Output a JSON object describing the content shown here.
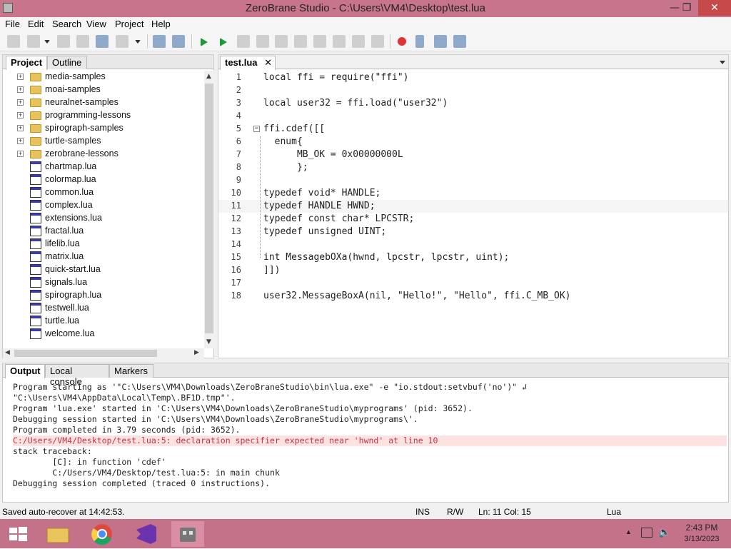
{
  "window": {
    "title": "ZeroBrane Studio - C:\\Users\\VM4\\Desktop\\test.lua",
    "minimize": "—",
    "restore": "❐",
    "close": "✕"
  },
  "menu": [
    "File",
    "Edit",
    "Search",
    "View",
    "Project",
    "Help"
  ],
  "project_panel": {
    "tabs": [
      "Project",
      "Outline"
    ],
    "items": [
      {
        "type": "folder",
        "label": "media-samples"
      },
      {
        "type": "folder",
        "label": "moai-samples"
      },
      {
        "type": "folder",
        "label": "neuralnet-samples"
      },
      {
        "type": "folder",
        "label": "programming-lessons"
      },
      {
        "type": "folder",
        "label": "spirograph-samples"
      },
      {
        "type": "folder",
        "label": "turtle-samples"
      },
      {
        "type": "folder",
        "label": "zerobrane-lessons"
      },
      {
        "type": "file",
        "label": "chartmap.lua"
      },
      {
        "type": "file",
        "label": "colormap.lua"
      },
      {
        "type": "file",
        "label": "common.lua"
      },
      {
        "type": "file",
        "label": "complex.lua"
      },
      {
        "type": "file",
        "label": "extensions.lua"
      },
      {
        "type": "file",
        "label": "fractal.lua"
      },
      {
        "type": "file",
        "label": "lifelib.lua"
      },
      {
        "type": "file",
        "label": "matrix.lua"
      },
      {
        "type": "file",
        "label": "quick-start.lua"
      },
      {
        "type": "file",
        "label": "signals.lua"
      },
      {
        "type": "file",
        "label": "spirograph.lua"
      },
      {
        "type": "file",
        "label": "testwell.lua"
      },
      {
        "type": "file",
        "label": "turtle.lua"
      },
      {
        "type": "file",
        "label": "welcome.lua"
      }
    ]
  },
  "editor": {
    "tab_label": "test.lua",
    "tab_close": "✕",
    "lines": [
      {
        "n": "1",
        "code": "local ffi = require(\"ffi\")"
      },
      {
        "n": "2",
        "code": ""
      },
      {
        "n": "3",
        "code": "local user32 = ffi.load(\"user32\")"
      },
      {
        "n": "4",
        "code": ""
      },
      {
        "n": "5",
        "code": "ffi.cdef([["
      },
      {
        "n": "6",
        "code": "  enum{"
      },
      {
        "n": "7",
        "code": "      MB_OK = 0x00000000L"
      },
      {
        "n": "8",
        "code": "      };"
      },
      {
        "n": "9",
        "code": ""
      },
      {
        "n": "10",
        "code": "typedef void* HANDLE;"
      },
      {
        "n": "11",
        "code": "typedef HANDLE HWND;"
      },
      {
        "n": "12",
        "code": "typedef const char* LPCSTR;"
      },
      {
        "n": "13",
        "code": "typedef unsigned UINT;"
      },
      {
        "n": "14",
        "code": ""
      },
      {
        "n": "15",
        "code": "int MessagebOXa(hwnd, lpcstr, lpcstr, uint);"
      },
      {
        "n": "16",
        "code": "]])"
      },
      {
        "n": "17",
        "code": ""
      },
      {
        "n": "18",
        "code": "user32.MessageBoxA(nil, \"Hello!\", \"Hello\", ffi.C_MB_OK)"
      }
    ],
    "fold_marker": "−"
  },
  "output_panel": {
    "tabs": [
      "Output",
      "Local console",
      "Markers"
    ],
    "lines": [
      {
        "text": "Program starting as '\"C:\\Users\\VM4\\Downloads\\ZeroBraneStudio\\bin\\lua.exe\" -e \"io.stdout:setvbuf('no')\" ↲",
        "error": false
      },
      {
        "text": "\"C:\\Users\\VM4\\AppData\\Local\\Temp\\.BF1D.tmp\"'.",
        "error": false
      },
      {
        "text": "Program 'lua.exe' started in 'C:\\Users\\VM4\\Downloads\\ZeroBraneStudio\\myprograms' (pid: 3652).",
        "error": false
      },
      {
        "text": "Debugging session started in 'C:\\Users\\VM4\\Downloads\\ZeroBraneStudio\\myprograms\\'.",
        "error": false
      },
      {
        "text": "Program completed in 3.79 seconds (pid: 3652).",
        "error": false
      },
      {
        "text": "C:/Users/VM4/Desktop/test.lua:5: declaration specifier expected near 'hwnd' at line 10",
        "error": true
      },
      {
        "text": "stack traceback:",
        "error": false
      },
      {
        "text": "        [C]: in function 'cdef'",
        "error": false
      },
      {
        "text": "        C:/Users/VM4/Desktop/test.lua:5: in main chunk",
        "error": false
      },
      {
        "text": "Debugging session completed (traced 0 instructions).",
        "error": false
      }
    ]
  },
  "status": {
    "message": "Saved auto-recover at 14:42:53.",
    "mode": "INS",
    "rw": "R/W",
    "position": "Ln: 11 Col: 15",
    "language": "Lua"
  },
  "taskbar": {
    "time": "2:43 PM",
    "date": "3/13/2023"
  },
  "colors": {
    "titlebar": "#c8758c",
    "taskbar": "#c4718a",
    "error_bg": "#fde2e2",
    "error_text": "#c0344a",
    "run_green": "#1e9a38",
    "breakpoint_red": "#dd3333"
  },
  "icons": {
    "tree_expand": "+",
    "arrow_up": "▲",
    "arrow_down": "▼",
    "arrow_left": "◀",
    "arrow_right": "▶",
    "tray_up": "▲",
    "speaker": "🔈"
  }
}
